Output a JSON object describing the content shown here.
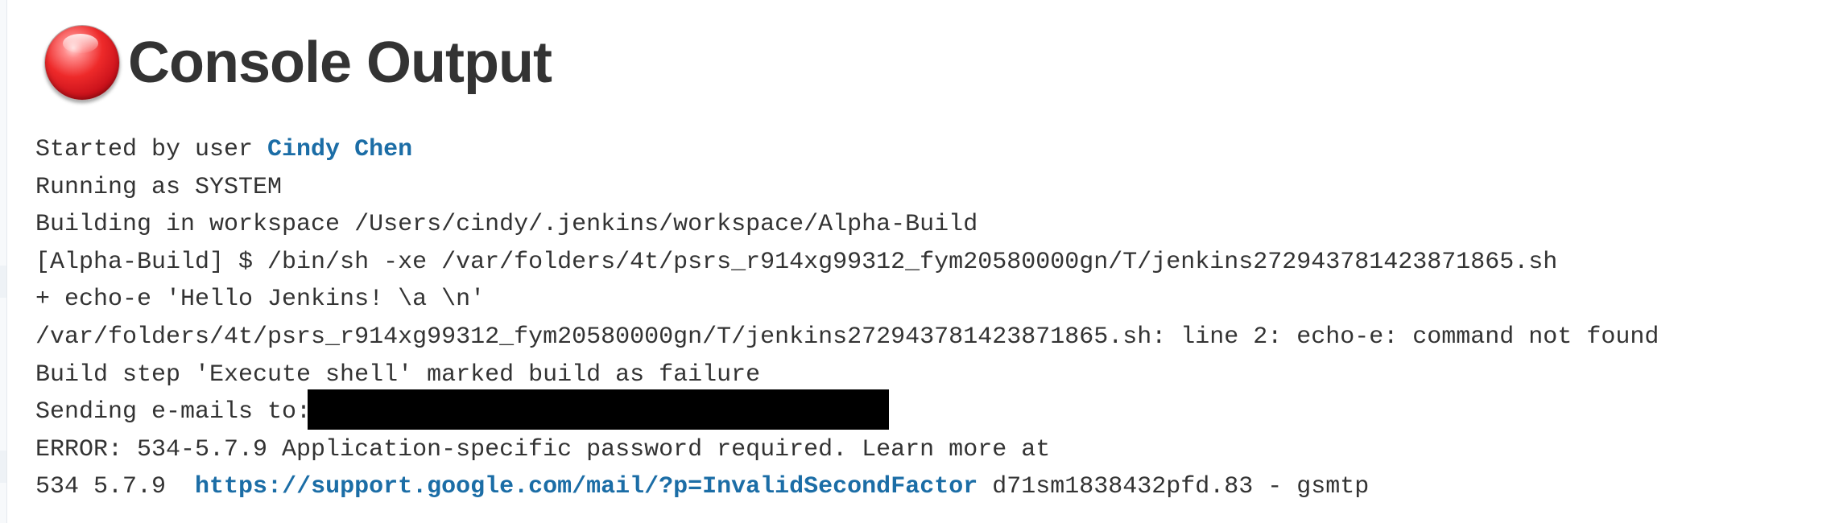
{
  "header": {
    "title": "Console Output",
    "status_icon": "red-ball-icon",
    "status_color": "#e32b2b"
  },
  "console": {
    "started_prefix": "Started by user ",
    "started_user": "Cindy Chen",
    "line_running": "Running as SYSTEM",
    "line_building": "Building in workspace /Users/cindy/.jenkins/workspace/Alpha-Build",
    "line_command": "[Alpha-Build] $ /bin/sh -xe /var/folders/4t/psrs_r914xg99312_fym20580000gn/T/jenkins272943781423871865.sh",
    "line_echo": "+ echo-e 'Hello Jenkins! \\a \\n'",
    "line_error_notfound": "/var/folders/4t/psrs_r914xg99312_fym20580000gn/T/jenkins272943781423871865.sh: line 2: echo-e: command not found",
    "line_failure": "Build step 'Execute shell' marked build as failure",
    "sending_prefix": "Sending e-mails to:",
    "line_error_534": "ERROR: 534-5.7.9 Application-specific password required. Learn more at",
    "last_prefix": "534 5.7.9  ",
    "last_link": "https://support.google.com/mail/?p=InvalidSecondFactor",
    "last_suffix": " d71sm1838432pfd.83 - gsmtp"
  },
  "colors": {
    "link": "#1b6da6",
    "text": "#333333"
  }
}
